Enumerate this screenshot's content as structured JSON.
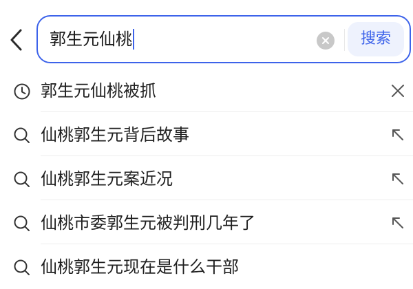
{
  "search": {
    "query": "郭生元仙桃",
    "button_label": "搜索"
  },
  "suggestions": [
    {
      "text": "郭生元仙桃被抓",
      "icon": "history-clock-icon",
      "action": "remove-x-icon"
    },
    {
      "text": "仙桃郭生元背后故事",
      "icon": "search-icon",
      "action": "fill-arrow-icon"
    },
    {
      "text": "仙桃郭生元案近况",
      "icon": "search-icon",
      "action": "fill-arrow-icon"
    },
    {
      "text": "仙桃市委郭生元被判刑几年了",
      "icon": "search-icon",
      "action": "fill-arrow-icon"
    },
    {
      "text": "仙桃郭生元现在是什么干部",
      "icon": "search-icon",
      "action": ""
    }
  ],
  "colors": {
    "accent": "#3d63ea",
    "search_button_bg": "#eef2fd",
    "divider": "#ececec",
    "clear_icon_bg": "#c8c8c8"
  }
}
